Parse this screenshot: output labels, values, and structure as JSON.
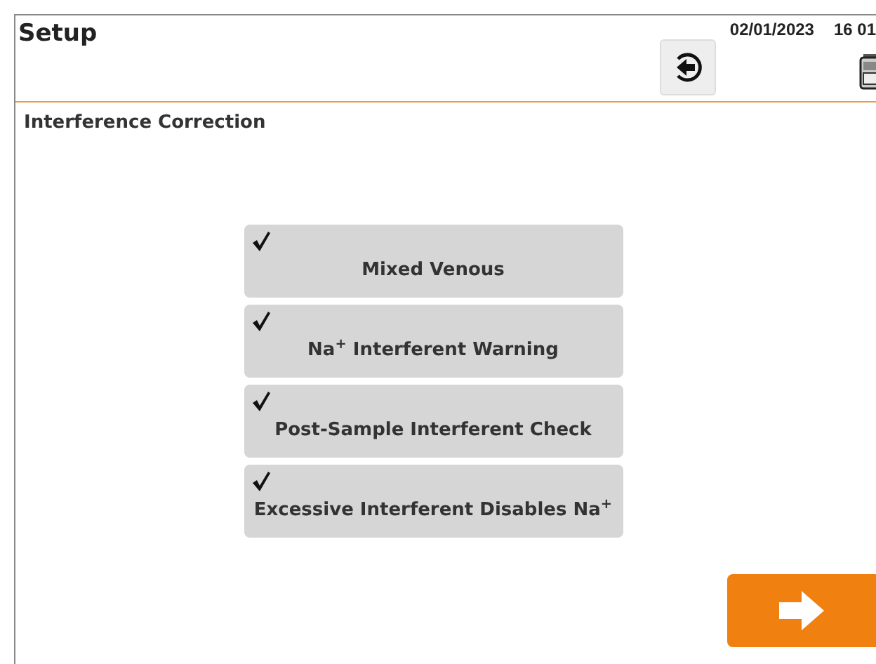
{
  "header": {
    "title": "Setup",
    "date": "02/01/2023",
    "time": "16 01"
  },
  "section_title": "Interference Correction",
  "options": [
    {
      "label": "Mixed Venous",
      "checked": true
    },
    {
      "label": "Na$^{+}$ Interferent Warning",
      "checked": true
    },
    {
      "label": "Post-Sample Interferent Check",
      "checked": true
    },
    {
      "label": "Excessive Interferent Disables Na$^{+}$",
      "checked": true
    }
  ]
}
